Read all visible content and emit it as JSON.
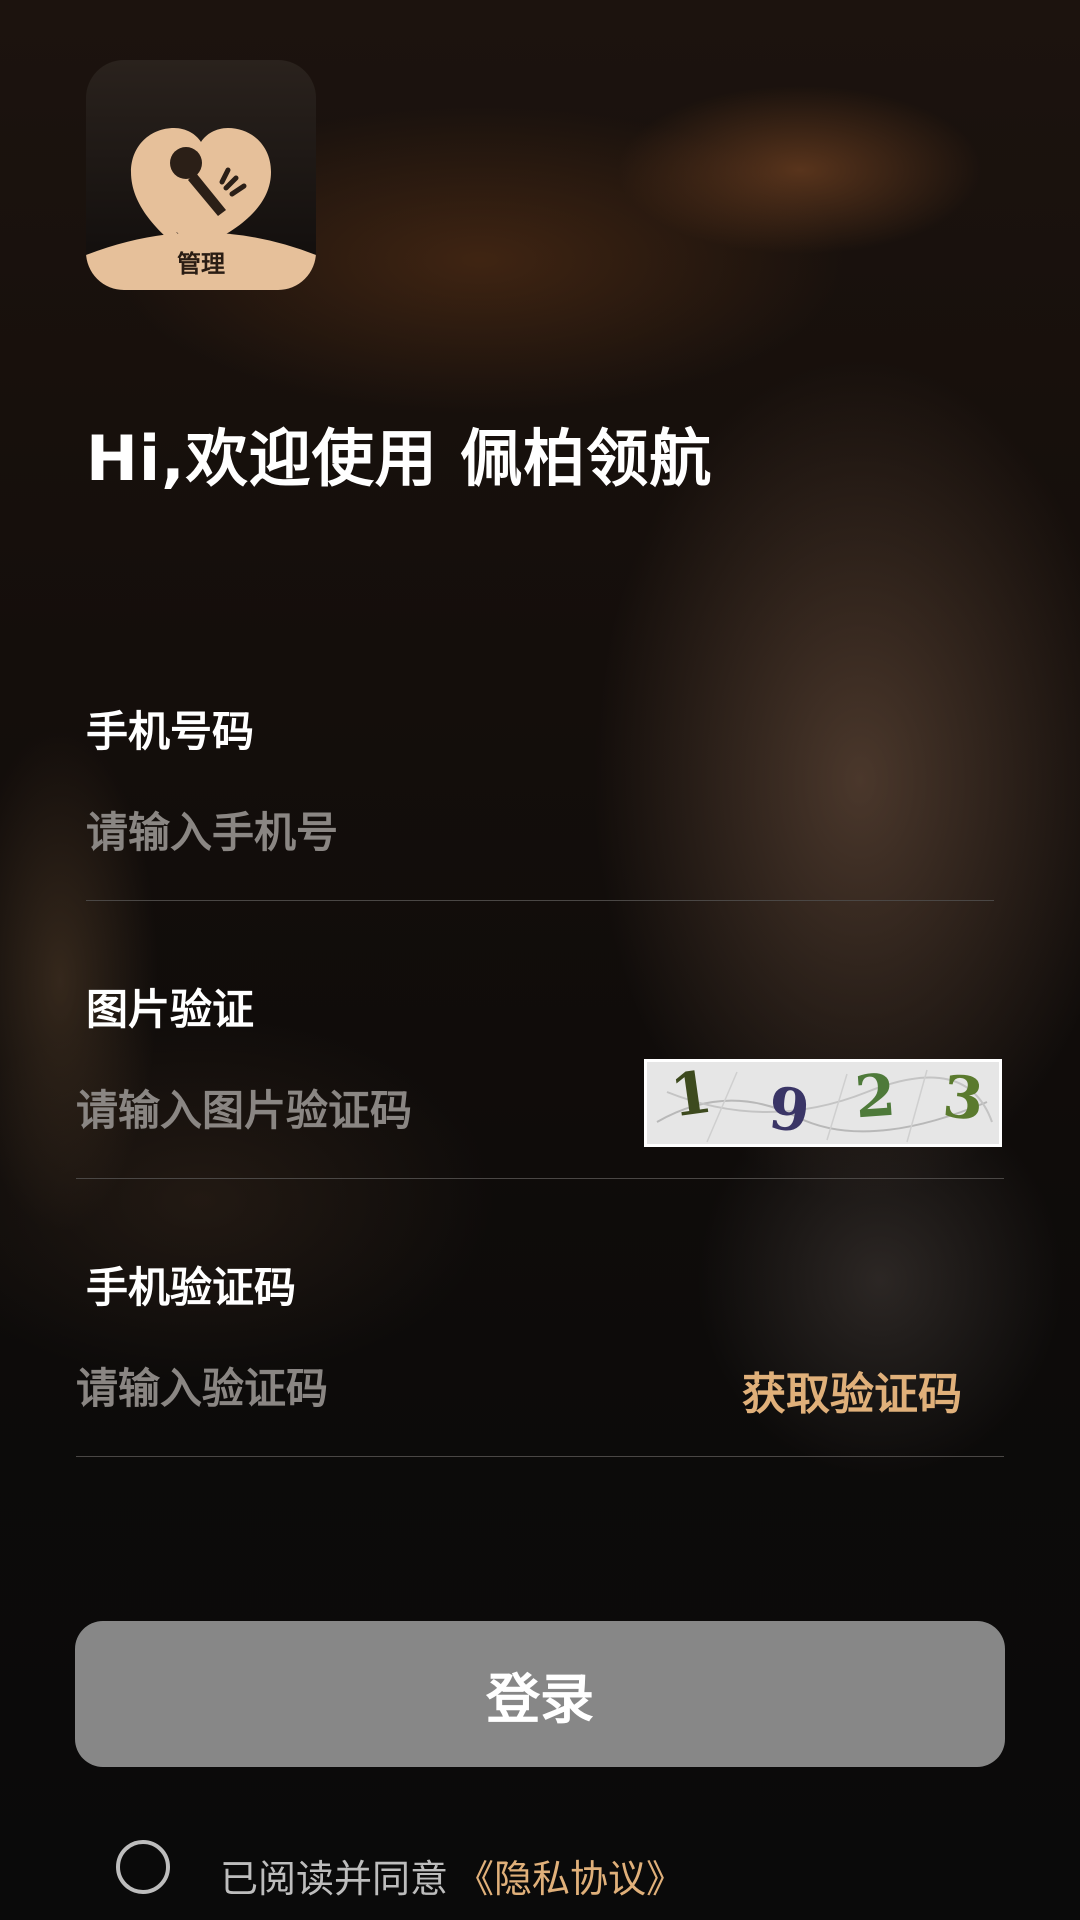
{
  "app": {
    "logo_icon": "heart-microphone-logo-icon",
    "logo_label": "管理",
    "greeting": "Hi,欢迎使用 佩柏领航"
  },
  "form": {
    "phone": {
      "label": "手机号码",
      "placeholder": "请输入手机号",
      "value": ""
    },
    "image_captcha": {
      "label": "图片验证",
      "placeholder": "请输入图片验证码",
      "value": "",
      "captcha_chars": [
        "1",
        "9",
        "2",
        "3"
      ]
    },
    "sms_code": {
      "label": "手机验证码",
      "placeholder": "请输入验证码",
      "value": "",
      "get_code_label": "获取验证码"
    },
    "login_label": "登录"
  },
  "agreement": {
    "checked": false,
    "text": "已阅读并同意",
    "link_label": "《隐私协议》"
  },
  "colors": {
    "accent": "#e0b07a",
    "button_disabled": "#878787",
    "placeholder": "#8a8683"
  }
}
